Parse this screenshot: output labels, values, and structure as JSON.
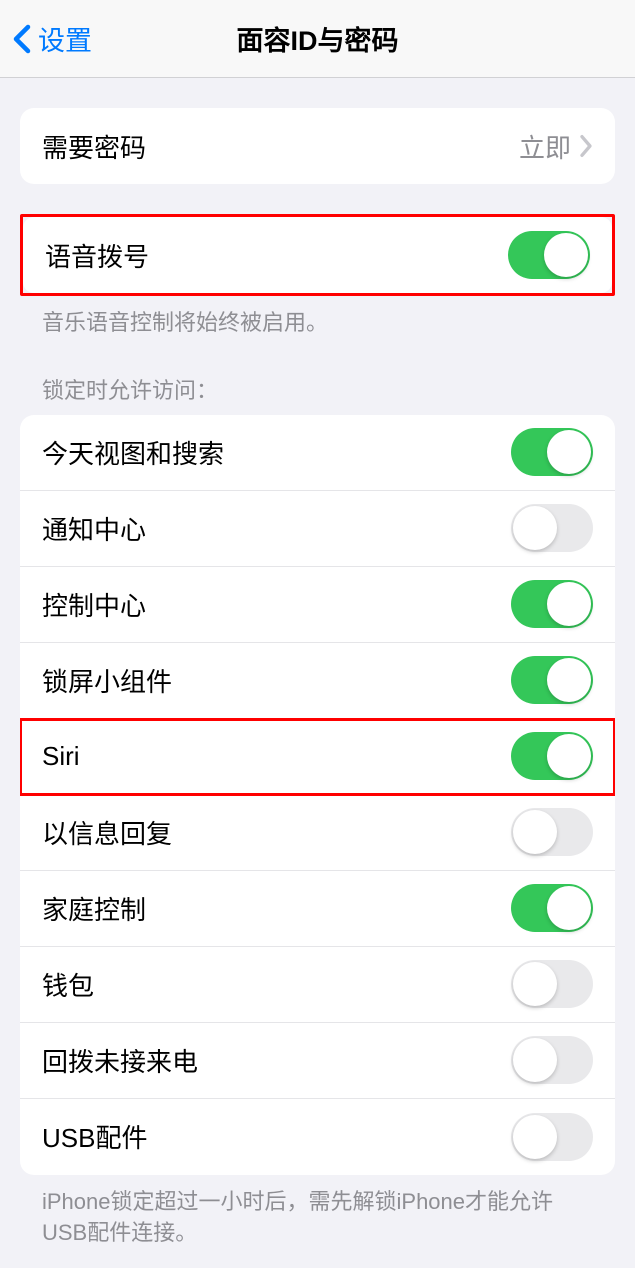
{
  "nav": {
    "back_label": "设置",
    "title": "面容ID与密码"
  },
  "group_passcode": {
    "require_label": "需要密码",
    "require_value": "立即"
  },
  "group_voice": {
    "voice_dial_label": "语音拨号",
    "voice_dial_on": true,
    "footer": "音乐语音控制将始终被启用。"
  },
  "group_lock_access": {
    "header": "锁定时允许访问：",
    "items": [
      {
        "label": "今天视图和搜索",
        "on": true
      },
      {
        "label": "通知中心",
        "on": false
      },
      {
        "label": "控制中心",
        "on": true
      },
      {
        "label": "锁屏小组件",
        "on": true
      },
      {
        "label": "Siri",
        "on": true
      },
      {
        "label": "以信息回复",
        "on": false
      },
      {
        "label": "家庭控制",
        "on": true
      },
      {
        "label": "钱包",
        "on": false
      },
      {
        "label": "回拨未接来电",
        "on": false
      },
      {
        "label": "USB配件",
        "on": false
      }
    ],
    "footer": "iPhone锁定超过一小时后，需先解锁iPhone才能允许USB配件连接。"
  },
  "highlights": {
    "voice_group": true,
    "siri_row_index": 4
  }
}
